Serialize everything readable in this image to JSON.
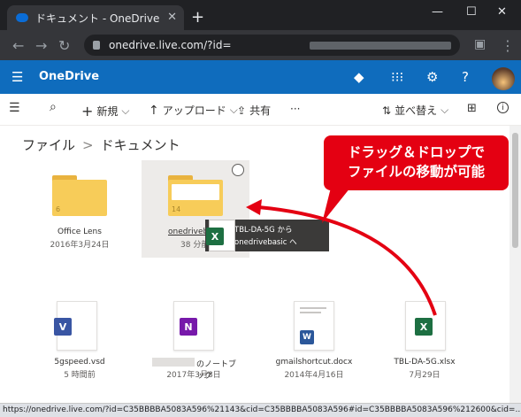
{
  "browser": {
    "tab_title": "ドキュメント - OneDrive",
    "url": "onedrive.live.com/?id=",
    "status_url": "https://onedrive.live.com/?id=C35BBBBA5083A596%21143&cid=C35BBBBA5083A596#id=C35BBBBA5083A596%212600&cid=..."
  },
  "app": {
    "name": "OneDrive"
  },
  "commands": {
    "new": "新規",
    "upload": "アップロード",
    "share": "共有",
    "more": "···",
    "sort": "並べ替え"
  },
  "breadcrumb": {
    "root": "ファイル",
    "sep": ">",
    "current": "ドキュメント"
  },
  "items": {
    "office_lens": {
      "name": "Office Lens",
      "date": "2016年3月24日",
      "count": "6"
    },
    "onedrivebasic": {
      "name": "onedriveb",
      "date": "38 分前",
      "count": "14"
    },
    "sgspeed": {
      "name": "5gspeed.vsd",
      "date": "5 時間前",
      "badge": "V"
    },
    "notebook": {
      "name": "のノートブック",
      "date": "2017年3月8日",
      "badge": "N"
    },
    "gmail": {
      "name": "gmailshortcut.docx",
      "date": "2014年4月16日",
      "badge": "W"
    },
    "tbl": {
      "name": "TBL-DA-5G.xlsx",
      "date": "7月29日",
      "badge": "X"
    }
  },
  "drag_tooltip": {
    "line1": "TBL-DA-5G から",
    "line2": "onedrivebasic へ",
    "badge": "X"
  },
  "callout": {
    "line1": "ドラッグ＆ドロップで",
    "line2": "ファイルの移動が可能"
  },
  "colors": {
    "accent": "#0f6cbd",
    "callout": "#e40012"
  }
}
